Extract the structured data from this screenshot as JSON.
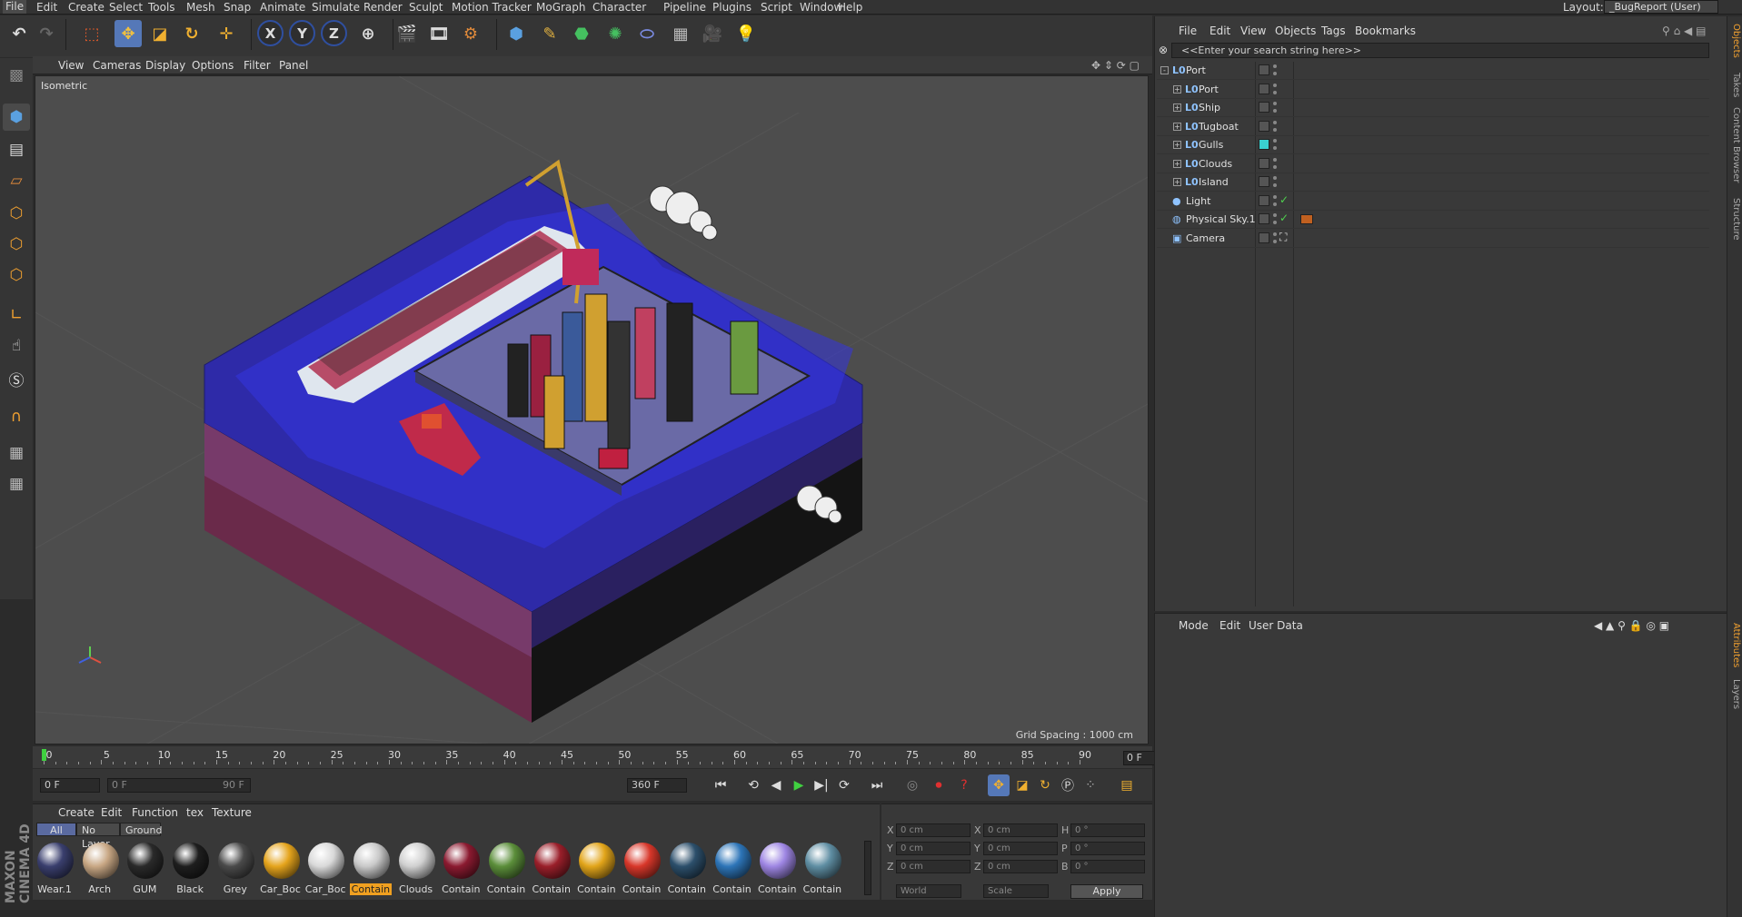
{
  "menubar": {
    "items": [
      "File",
      "Edit",
      "Create",
      "Select",
      "Tools",
      "Mesh",
      "Snap",
      "Animate",
      "Simulate",
      "Render",
      "Sculpt",
      "Motion Tracker",
      "MoGraph",
      "Character",
      "Pipeline",
      "Plugins",
      "Script",
      "Window",
      "Help"
    ],
    "layout_label": "Layout:",
    "layout_value": "_BugReport (User)"
  },
  "viewport": {
    "menu": [
      "View",
      "Cameras",
      "Display",
      "Options",
      "Filter",
      "Panel"
    ],
    "projection": "Isometric",
    "grid_spacing": "Grid Spacing : 1000 cm"
  },
  "timeline": {
    "ticks": [
      "0",
      "5",
      "10",
      "15",
      "20",
      "25",
      "30",
      "35",
      "40",
      "45",
      "50",
      "55",
      "60",
      "65",
      "70",
      "75",
      "80",
      "85",
      "90"
    ],
    "current_frame": "0 F",
    "start_frame": "0 F",
    "range_start": "0 F",
    "range_end": "90 F",
    "end_frame": "360 F"
  },
  "material_manager": {
    "menu": [
      "Create",
      "Edit",
      "Function",
      "tex",
      "Texture"
    ],
    "tabs": [
      "All",
      "No Layer",
      "Ground"
    ],
    "materials": [
      {
        "name": "Wear.1",
        "color": "#3a3f6e"
      },
      {
        "name": "Arch",
        "color": "#c8a784"
      },
      {
        "name": "GUM",
        "color": "#2a2a2a"
      },
      {
        "name": "Black",
        "color": "#1e1e1e"
      },
      {
        "name": "Grey",
        "color": "#4a4a4a"
      },
      {
        "name": "Car_Boc",
        "color": "#e5a41c"
      },
      {
        "name": "Car_Boc",
        "color": "#d9d9d9"
      },
      {
        "name": "Contain",
        "color": "#c9c9c9"
      },
      {
        "name": "Clouds",
        "color": "#d0d0d0"
      },
      {
        "name": "Contain",
        "color": "#8b1a30"
      },
      {
        "name": "Contain",
        "color": "#5b8e3a"
      },
      {
        "name": "Contain",
        "color": "#9a1f2a"
      },
      {
        "name": "Contain",
        "color": "#e2a51a"
      },
      {
        "name": "Contain",
        "color": "#d8372a"
      },
      {
        "name": "Contain",
        "color": "#2c4f6b"
      },
      {
        "name": "Contain",
        "color": "#2d75b8"
      },
      {
        "name": "Contain",
        "color": "#9e86e3"
      },
      {
        "name": "Contain",
        "color": "#5f8ea3"
      }
    ]
  },
  "coordinates": {
    "col1": [
      "X",
      "Y",
      "Z"
    ],
    "col2": [
      "X",
      "Y",
      "Z"
    ],
    "col3": [
      "H",
      "P",
      "B"
    ],
    "pos": [
      "0 cm",
      "0 cm",
      "0 cm"
    ],
    "size": [
      "0 cm",
      "0 cm",
      "0 cm"
    ],
    "rot": [
      "0 °",
      "0 °",
      "0 °"
    ],
    "mode_world": "World",
    "mode_scale": "Scale",
    "apply": "Apply"
  },
  "object_manager": {
    "menu": [
      "File",
      "Edit",
      "View",
      "Objects",
      "Tags",
      "Bookmarks"
    ],
    "search_placeholder": "<<Enter your search string here>>",
    "objects": [
      {
        "name": "Port",
        "indent": 0,
        "expand": "-",
        "icon": "L0"
      },
      {
        "name": "Port",
        "indent": 1,
        "expand": "+",
        "icon": "L0"
      },
      {
        "name": "Ship",
        "indent": 1,
        "expand": "+",
        "icon": "L0"
      },
      {
        "name": "Tugboat",
        "indent": 1,
        "expand": "+",
        "icon": "L0"
      },
      {
        "name": "Gulls",
        "indent": 1,
        "expand": "+",
        "icon": "L0"
      },
      {
        "name": "Clouds",
        "indent": 1,
        "expand": "+",
        "icon": "L0"
      },
      {
        "name": "Island",
        "indent": 1,
        "expand": "+",
        "icon": "L0"
      },
      {
        "name": "Light",
        "indent": 0,
        "expand": "",
        "icon": "●"
      },
      {
        "name": "Physical Sky.1",
        "indent": 0,
        "expand": "",
        "icon": "◍"
      },
      {
        "name": "Camera",
        "indent": 0,
        "expand": "",
        "icon": "▣"
      }
    ]
  },
  "attribute_manager": {
    "menu": [
      "Mode",
      "Edit",
      "User Data"
    ]
  },
  "right_tabs": [
    "Objects",
    "Takes",
    "Content Browser",
    "Structure",
    "Attributes",
    "Layers"
  ],
  "brand": "MAXON CINEMA 4D"
}
